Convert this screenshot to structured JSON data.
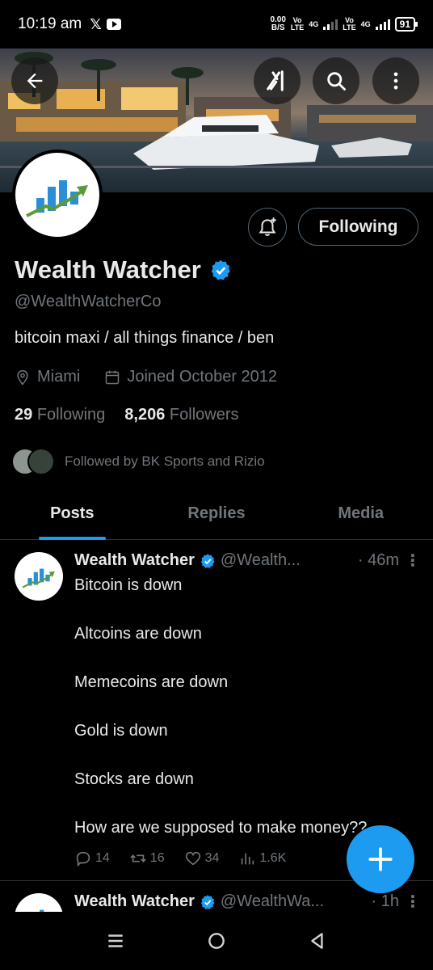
{
  "status_bar": {
    "time": "10:19 am",
    "speed_value": "0.00",
    "speed_unit": "B/S",
    "net1": "Vo\nLTE",
    "net1_type": "4G",
    "net2": "Vo\nLTE",
    "net2_type": "4G",
    "battery": "91"
  },
  "header": {
    "back_icon": "arrow-left-icon",
    "grok_icon": "grok-icon",
    "search_icon": "search-icon",
    "more_icon": "more-vertical-icon"
  },
  "profile": {
    "name": "Wealth Watcher",
    "handle": "@WealthWatcherCo",
    "bio": "bitcoin maxi / all things finance / ben",
    "location": "Miami",
    "joined": "Joined October 2012",
    "following_count": "29",
    "following_label": "Following",
    "followers_count": "8,206",
    "followers_label": "Followers",
    "followed_by": "Followed by BK Sports and Rizio",
    "follow_button": "Following",
    "verified_color": "#1d9bf0"
  },
  "tabs": [
    {
      "label": "Posts",
      "active": true
    },
    {
      "label": "Replies",
      "active": false
    },
    {
      "label": "Media",
      "active": false
    }
  ],
  "tweets": [
    {
      "name": "Wealth Watcher",
      "handle": "@Wealth...",
      "time": "· 46m",
      "lines": [
        "Bitcoin is down",
        "Altcoins are down",
        "Memecoins are down",
        "Gold is down",
        "Stocks are down",
        "How are we supposed to make money??"
      ],
      "replies": "14",
      "retweets": "16",
      "likes": "34",
      "views": "1.6K"
    },
    {
      "name": "Wealth Watcher",
      "handle": "@WealthWa...",
      "time": "· 1h"
    }
  ],
  "fab_icon": "plus-icon",
  "nav": {
    "menu_icon": "recent-apps-icon",
    "home_icon": "home-circle-icon",
    "back_icon": "back-triangle-icon"
  }
}
